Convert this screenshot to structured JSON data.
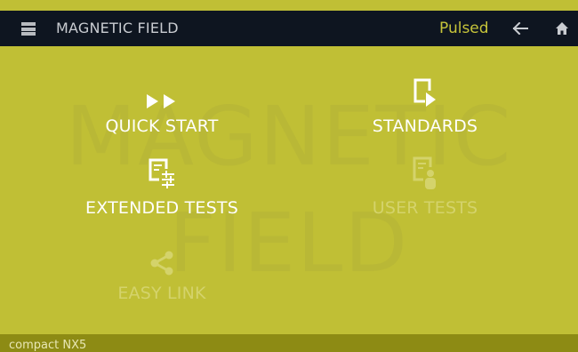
{
  "header": {
    "title": "MAGNETIC FIELD",
    "mode": "Pulsed",
    "icons": {
      "menu": "menu-icon",
      "back": "arrow-left-icon",
      "home": "home-icon"
    }
  },
  "watermark": {
    "line1": "MAGNETIC",
    "line2": "FIELD"
  },
  "tiles": [
    {
      "label": "QUICK START",
      "icon": "fast-forward-icon",
      "enabled": true
    },
    {
      "label": "STANDARDS",
      "icon": "document-play-icon",
      "enabled": true
    },
    {
      "label": "EXTENDED TESTS",
      "icon": "document-sliders-icon",
      "enabled": true
    },
    {
      "label": "USER TESTS",
      "icon": "document-user-icon",
      "enabled": false
    },
    {
      "label": "EASY LINK",
      "icon": "share-icon",
      "enabled": false
    }
  ],
  "footer": {
    "device": "compact NX5"
  },
  "colors": {
    "background": "#c0bf35",
    "header": "#0e1520",
    "accent": "#c6c43a",
    "footer": "#8d8b14",
    "disabled_text": "#d4d36b"
  }
}
